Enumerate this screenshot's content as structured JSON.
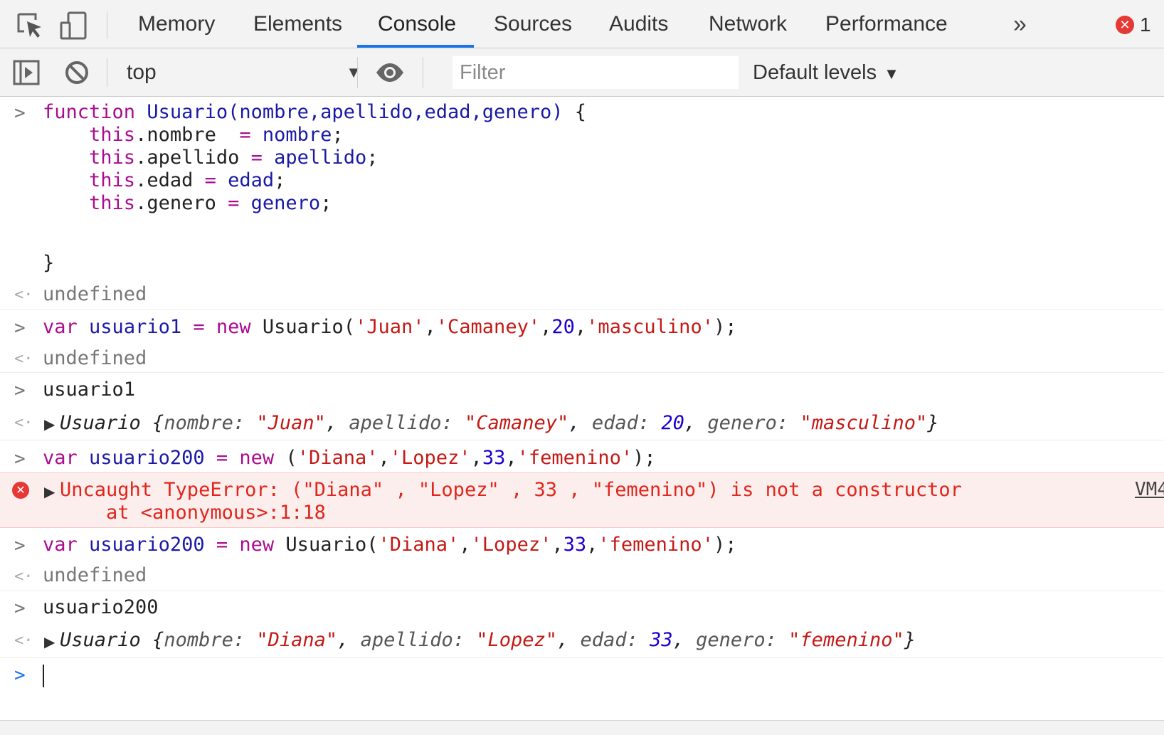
{
  "tabs": [
    {
      "label": "Memory"
    },
    {
      "label": "Elements"
    },
    {
      "label": "Console",
      "active": true
    },
    {
      "label": "Sources"
    },
    {
      "label": "Audits"
    },
    {
      "label": "Network"
    },
    {
      "label": "Performance"
    }
  ],
  "more_tabs_glyph": "»",
  "error_count": "1",
  "toolbar": {
    "context": "top",
    "filter_placeholder": "Filter",
    "levels_label": "Default levels"
  },
  "colors": {
    "accent": "#1a73e8",
    "keyword": "#aa0d91",
    "string": "#c41a16",
    "number": "#1c00cf",
    "error_text": "#e0261b",
    "error_bg": "#fdeeee"
  },
  "console": {
    "undefined_text": "undefined",
    "entry1": {
      "l1_kw": "function",
      "l1_name": "Usuario",
      "l1_params": "(nombre,apellido,edad,genero)",
      "l1_brace": " {",
      "this_kw": "this",
      "l2_prop": ".nombre  ",
      "l2_val": "nombre",
      "l3_prop": ".apellido ",
      "l3_val": "apellido",
      "l4_prop": ".edad ",
      "l4_val": "edad",
      "l5_prop": ".genero ",
      "l5_val": "genero",
      "close": "}"
    },
    "entry2": {
      "kw_var": "var",
      "name": "usuario1",
      "eq": " = ",
      "kw_new": "new",
      "ctor": " Usuario(",
      "a1": "'Juan'",
      "a2": "'Camaney'",
      "a3": "20",
      "a4": "'masculino'",
      "end": ");"
    },
    "entry3": {
      "input": "usuario1"
    },
    "entry3_out": {
      "cls": "Usuario ",
      "k1": "nombre: ",
      "v1": "\"Juan\"",
      "k2": "apellido: ",
      "v2": "\"Camaney\"",
      "k3": "edad: ",
      "v3": "20",
      "k4": "genero: ",
      "v4": "\"masculino\""
    },
    "entry4": {
      "kw_var": "var",
      "name": "usuario200",
      "kw_new": "new",
      "open": " (",
      "a1": "'Diana'",
      "a2": "'Lopez'",
      "a3": "33",
      "a4": "'femenino'",
      "end": ");"
    },
    "error": {
      "line1": "Uncaught TypeError: (\"Diana\" , \"Lopez\" , 33 , \"femenino\") is not a constructor",
      "line2": "    at <anonymous>:1:18",
      "source": "VM4"
    },
    "entry5": {
      "kw_var": "var",
      "name": "usuario200",
      "kw_new": "new",
      "ctor": " Usuario(",
      "a1": "'Diana'",
      "a2": "'Lopez'",
      "a3": "33",
      "a4": "'femenino'",
      "end": ");"
    },
    "entry6": {
      "input": "usuario200"
    },
    "entry6_out": {
      "cls": "Usuario ",
      "k1": "nombre: ",
      "v1": "\"Diana\"",
      "k2": "apellido: ",
      "v2": "\"Lopez\"",
      "k3": "edad: ",
      "v3": "33",
      "k4": "genero: ",
      "v4": "\"femenino\""
    }
  }
}
